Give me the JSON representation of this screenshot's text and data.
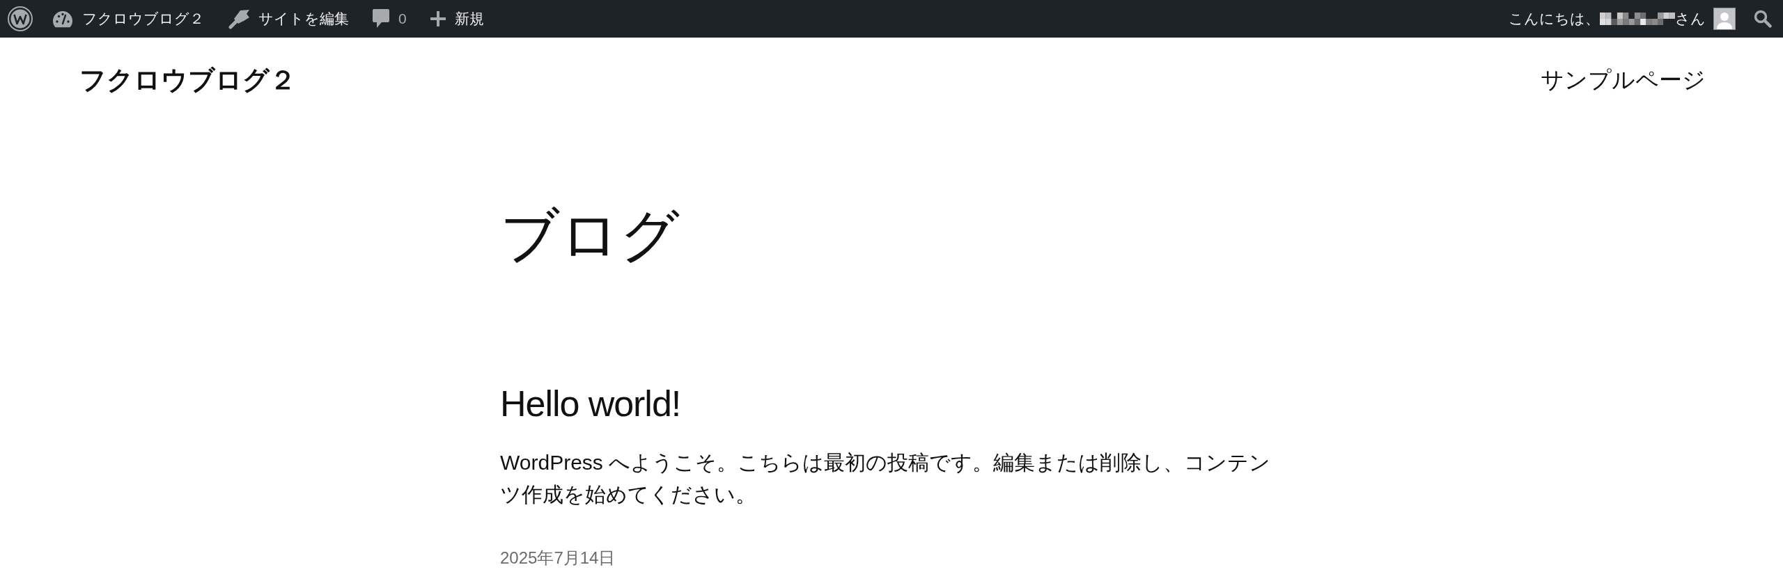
{
  "admin_bar": {
    "site_name": "フクロウブログ２",
    "edit_site": "サイトを編集",
    "comment_count": "0",
    "new": "新規",
    "greeting": "こんにちは、",
    "greeting_suffix": "さん"
  },
  "header": {
    "site_title": "フクロウブログ２",
    "nav": [
      {
        "label": "サンプルページ"
      }
    ]
  },
  "main": {
    "title": "ブログ",
    "posts": [
      {
        "title": "Hello world!",
        "excerpt": "WordPress へようこそ。こちらは最初の投稿です。編集または削除し、コンテンツ作成を始めてください。",
        "date": "2025年7月14日"
      }
    ]
  }
}
